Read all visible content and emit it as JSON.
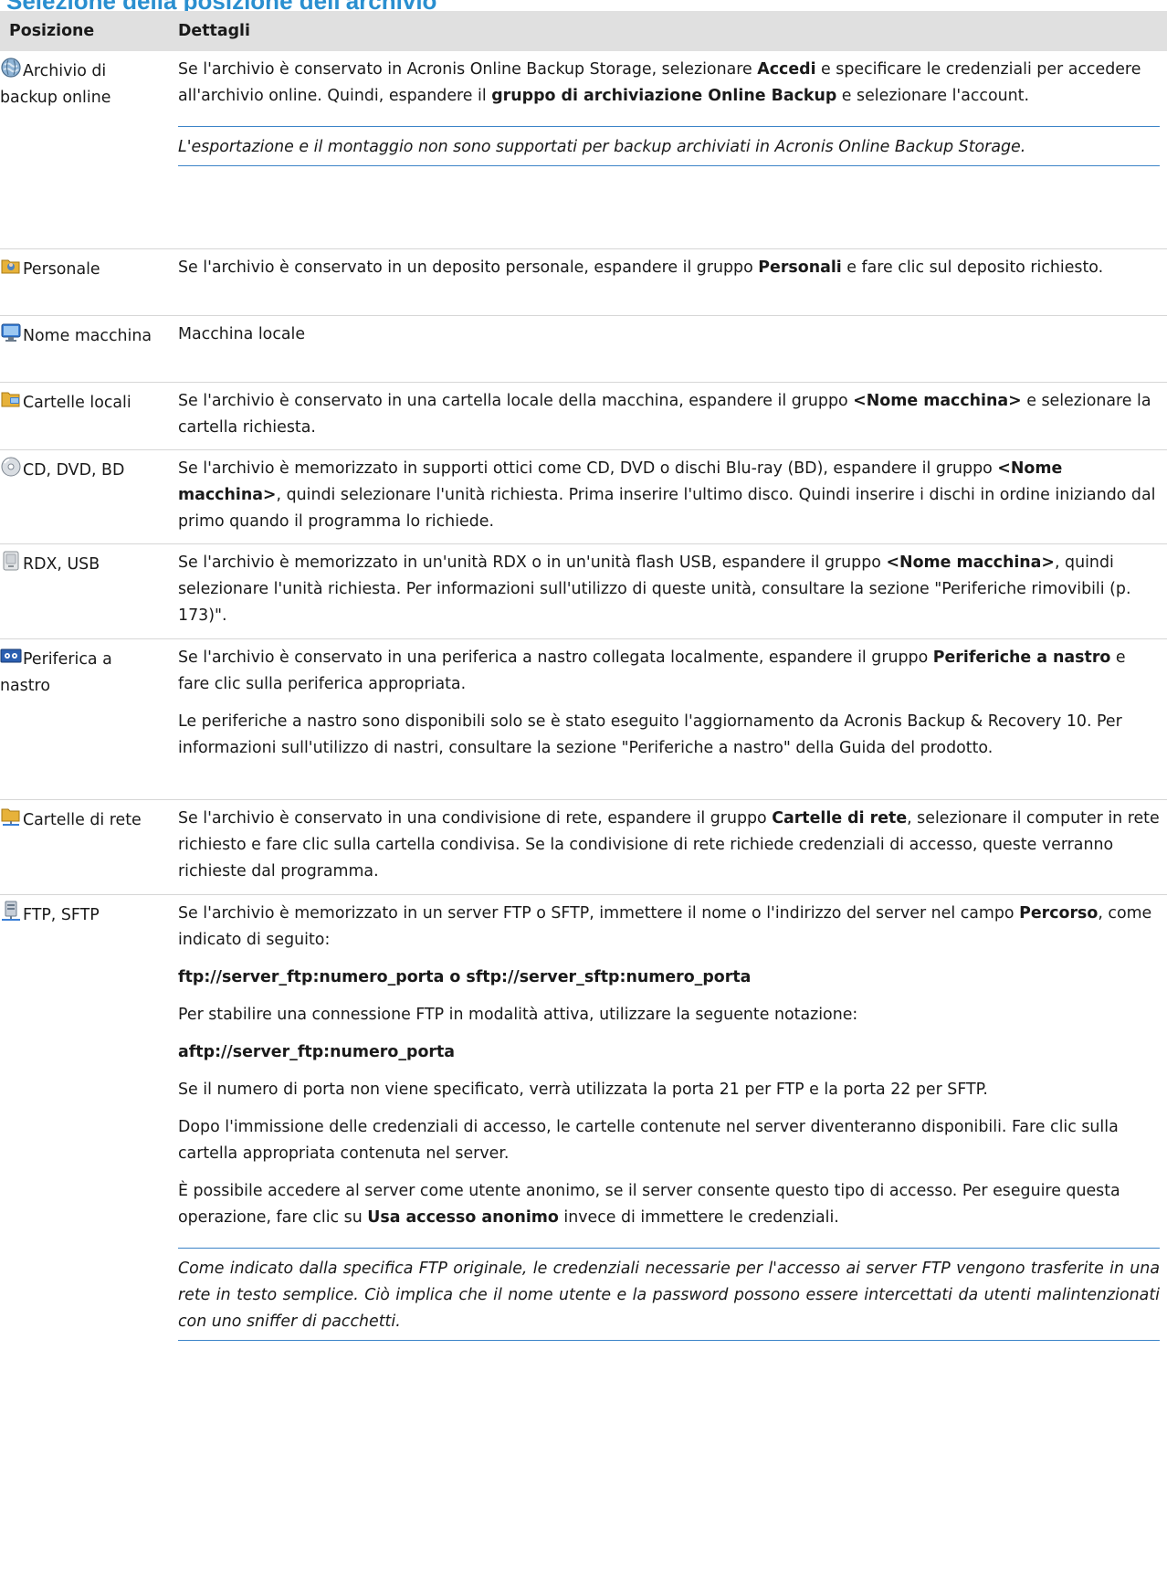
{
  "page_title": "Selezione della posizione dell'archivio",
  "headers": {
    "position": "Posizione",
    "details": "Dettagli"
  },
  "rows": [
    {
      "label": "Archivio di backup online",
      "icon": "globe-icon",
      "p1": [
        "Se l'archivio è conservato in Acronis Online Backup Storage, selezionare ",
        "Accedi",
        " e specificare le credenziali per accedere all'archivio online. Quindi, espandere il ",
        "gruppo di archiviazione Online Backup",
        " e selezionare l'account."
      ],
      "note": "L'esportazione e il montaggio non sono supportati per backup archiviati in Acronis Online Backup Storage."
    },
    {
      "label": "Personale",
      "icon": "personal-vault-icon",
      "p1": [
        "Se l'archivio è conservato in un deposito personale, espandere il gruppo ",
        "Personali",
        " e fare clic sul deposito richiesto."
      ]
    },
    {
      "label": "Nome macchina",
      "icon": "computer-icon",
      "p1": [
        "Macchina locale"
      ]
    },
    {
      "label": "Cartelle locali",
      "icon": "local-folder-icon",
      "p1": [
        "Se l'archivio è conservato in una cartella locale della macchina, espandere il gruppo ",
        "<Nome macchina>",
        " e selezionare la cartella richiesta."
      ]
    },
    {
      "label": "CD, DVD, BD",
      "icon": "optical-disc-icon",
      "p1": [
        "Se l'archivio è memorizzato in supporti ottici come CD, DVD o dischi Blu-ray (BD), espandere il gruppo ",
        "<Nome macchina>",
        ", quindi selezionare l'unità richiesta. Prima inserire l'ultimo disco. Quindi inserire i dischi in ordine iniziando dal primo quando il programma lo richiede."
      ]
    },
    {
      "label": "RDX, USB",
      "icon": "removable-drive-icon",
      "p1": [
        "Se l'archivio è memorizzato in un'unità RDX o in un'unità flash USB, espandere il gruppo ",
        "<Nome macchina>",
        ", quindi selezionare l'unità richiesta. Per informazioni sull'utilizzo di queste unità, consultare la sezione \"Periferiche rimovibili (p. 173)\"."
      ]
    },
    {
      "label": "Periferica a nastro",
      "icon": "tape-device-icon",
      "p1": [
        "Se l'archivio è conservato in una periferica a nastro collegata localmente, espandere il gruppo ",
        "Periferiche a nastro",
        " e fare clic sulla periferica appropriata."
      ],
      "p2": "Le periferiche a nastro sono disponibili solo se è stato eseguito l'aggiornamento da Acronis Backup & Recovery 10. Per informazioni sull'utilizzo di nastri, consultare la sezione \"Periferiche a nastro\" della Guida del prodotto."
    },
    {
      "label": "Cartelle di rete",
      "icon": "network-folder-icon",
      "p1": [
        "Se l'archivio è conservato in una condivisione di rete, espandere il gruppo ",
        "Cartelle di rete",
        ", selezionare il computer in rete richiesto e fare clic sulla cartella condivisa. Se la condivisione di rete richiede credenziali di accesso, queste verranno richieste dal programma."
      ]
    },
    {
      "label": "FTP, SFTP",
      "icon": "ftp-server-icon",
      "p1": [
        "Se l'archivio è memorizzato in un server FTP o SFTP, immettere il nome o l'indirizzo del server nel campo ",
        "Percorso",
        ", come indicato di seguito:"
      ],
      "ftp_syntax": "ftp://server_ftp:numero_porta o sftp://server_sftp:numero_porta",
      "p_active": "Per stabilire una connessione FTP in modalità attiva, utilizzare la seguente notazione:",
      "aftp_syntax": "aftp://server_ftp:numero_porta",
      "p_port": "Se il numero di porta non viene specificato, verrà utilizzata la porta 21 per FTP e la porta 22 per SFTP.",
      "p_after": "Dopo l'immissione delle credenziali di accesso, le cartelle contenute nel server diventeranno disponibili. Fare clic sulla cartella appropriata contenuta nel server.",
      "p_anon": [
        "È possibile accedere al server come utente anonimo, se il server consente questo tipo di accesso. Per eseguire questa operazione, fare clic su ",
        "Usa accesso anonimo",
        " invece di immettere le credenziali."
      ],
      "note": "Come indicato dalla specifica FTP originale, le credenziali necessarie per l'accesso ai server FTP vengono trasferite in una rete in testo semplice. Ciò implica che il nome utente e la password possono essere intercettati da utenti malintenzionati con uno sniffer di pacchetti."
    }
  ]
}
